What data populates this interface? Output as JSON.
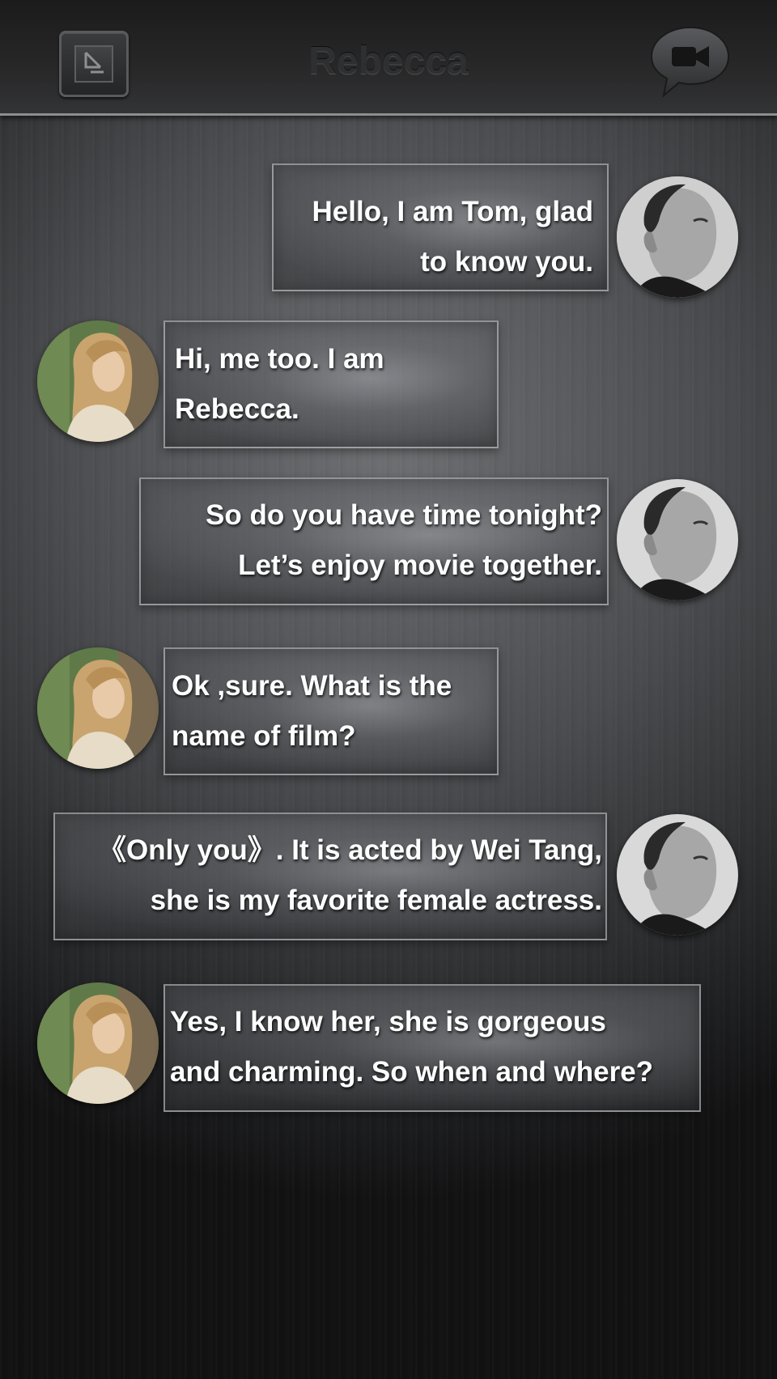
{
  "header": {
    "title": "Rebecca",
    "back_icon": "exit-arrow-icon",
    "video_icon": "video-camera-icon"
  },
  "colors": {
    "bubble_text": "#ffffff",
    "title_text": "#2e2f31",
    "header_divider": "#8d8e90"
  },
  "conversation": {
    "messages": [
      {
        "sender": "Tom",
        "lines": [
          "Hello, I am Tom, glad",
          "to know you."
        ]
      },
      {
        "sender": "Rebecca",
        "lines": [
          "Hi, me too. I am",
          "Rebecca."
        ]
      },
      {
        "sender": "Tom",
        "lines": [
          "So do you have time tonight?",
          "Let’s enjoy movie together."
        ]
      },
      {
        "sender": "Rebecca",
        "lines": [
          "Ok ,sure. What is the",
          "name of film?"
        ]
      },
      {
        "sender": "Tom",
        "lines": [
          "《Only you》. It is acted by Wei Tang,",
          "she is my favorite female actress."
        ]
      },
      {
        "sender": "Rebecca",
        "lines": [
          "Yes, I know her, she is gorgeous",
          "and charming. So when and where?"
        ]
      }
    ]
  }
}
